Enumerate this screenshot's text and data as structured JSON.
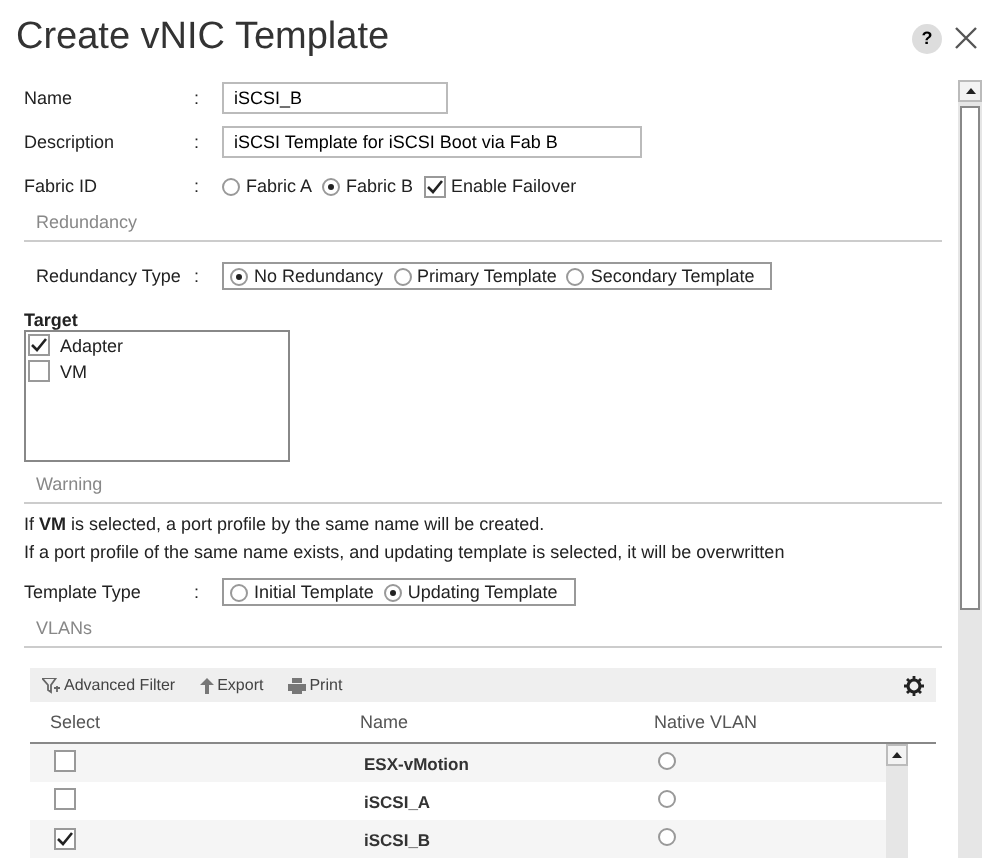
{
  "dialog": {
    "title": "Create vNIC Template",
    "help": "?"
  },
  "fields": [
    {
      "kind": "short_text",
      "label": "Name",
      "separator": ":",
      "value": "iSCSI_B"
    },
    {
      "kind": "long_text",
      "label": "Description",
      "separator": ":",
      "value": "iSCSI Template for iSCSI Boot via Fab B"
    },
    {
      "kind": "fabric",
      "label": "Fabric ID",
      "separator": ":",
      "options": [
        {
          "label": "Fabric A",
          "selected": false
        },
        {
          "label": "Fabric B",
          "selected": true
        }
      ],
      "failover": {
        "label": "Enable Failover",
        "checked": true
      }
    }
  ],
  "redundancy": {
    "title": "Redundancy",
    "label": "Redundancy Type",
    "separator": ":",
    "options": [
      {
        "label": "No Redundancy",
        "selected": true
      },
      {
        "label": "Primary Template",
        "selected": false
      },
      {
        "label": "Secondary Template",
        "selected": false
      }
    ]
  },
  "target": {
    "label": "Target",
    "items": [
      {
        "label": "Adapter",
        "checked": true
      },
      {
        "label": "VM",
        "checked": false
      }
    ]
  },
  "warning": {
    "title": "Warning",
    "lines": [
      "If **VM** is selected, a port profile by the same name will be created.",
      "If a port profile of the same name exists, and updating template is selected, it will be overwritten"
    ]
  },
  "template_type": {
    "label": "Template Type",
    "separator": ":",
    "options": [
      {
        "label": "Initial Template",
        "selected": false
      },
      {
        "label": "Updating Template",
        "selected": true
      }
    ]
  },
  "vlans": {
    "title": "VLANs",
    "toolbar": [
      {
        "kind": "filter",
        "label": "Advanced Filter"
      },
      {
        "kind": "export",
        "label": "Export"
      },
      {
        "kind": "print",
        "label": "Print"
      }
    ],
    "columns": [
      "Select",
      "Name",
      "Native VLAN"
    ],
    "rows": [
      {
        "checked": false,
        "name": "ESX-vMotion",
        "native": false
      },
      {
        "checked": false,
        "name": "iSCSI_A",
        "native": false
      },
      {
        "checked": true,
        "name": "iSCSI_B",
        "native": false
      }
    ]
  }
}
